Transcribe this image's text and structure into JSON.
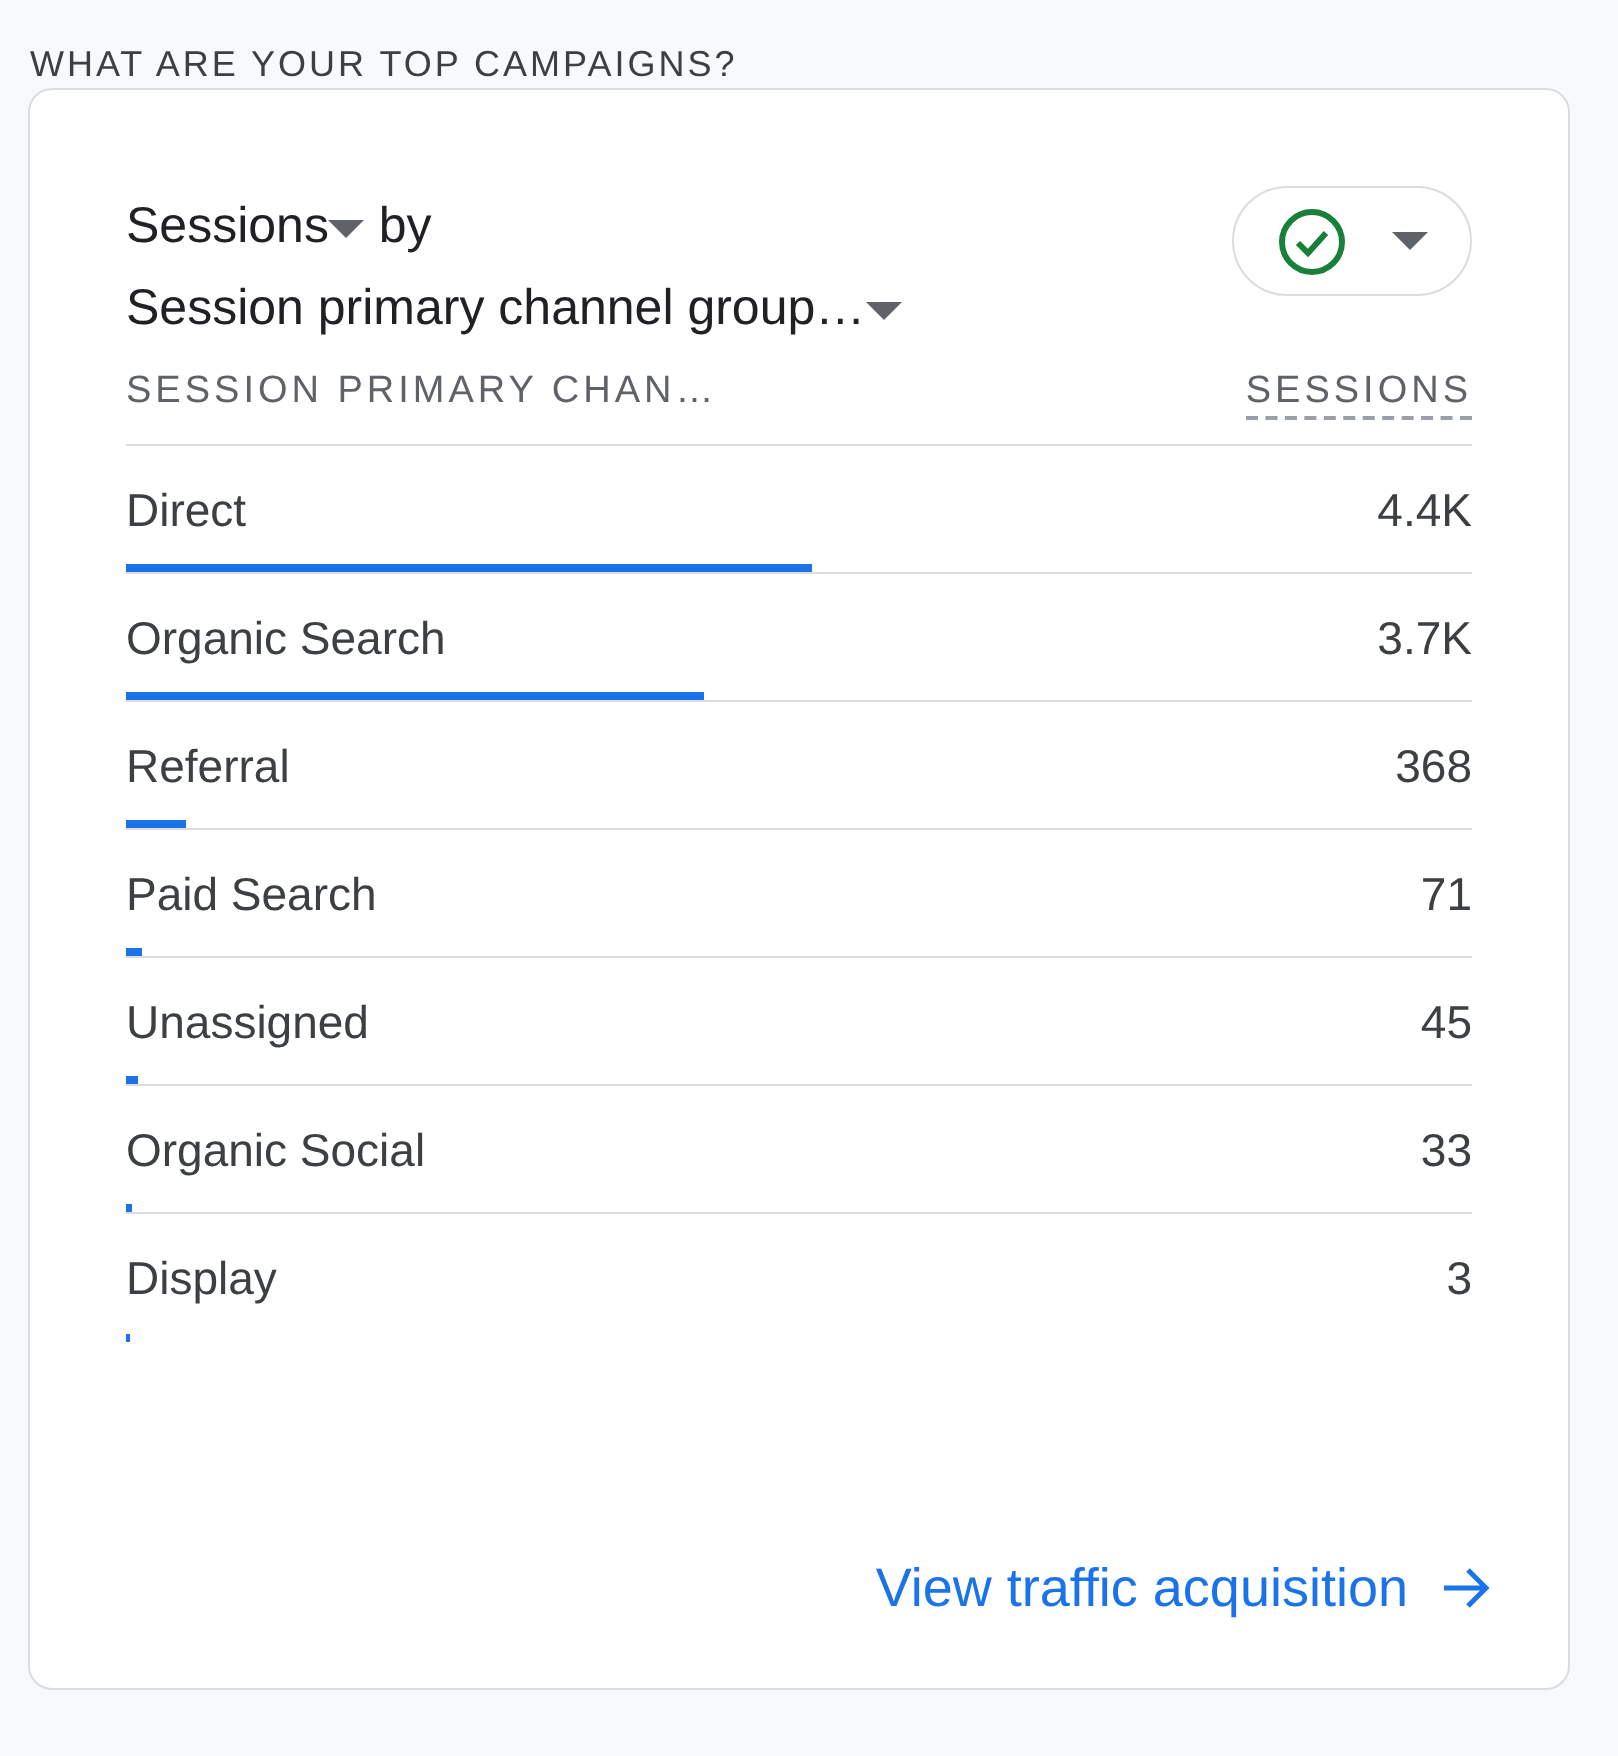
{
  "section_title": "WHAT ARE YOUR TOP CAMPAIGNS?",
  "card": {
    "metric": "Sessions",
    "by": "by",
    "dimension": "Session primary channel group…",
    "columns": [
      "SESSION PRIMARY CHAN…",
      "SESSIONS"
    ],
    "rows": [
      {
        "label": "Direct",
        "value": "4.4K",
        "level": 0.51
      },
      {
        "label": "Organic Search",
        "value": "3.7K",
        "level": 0.43
      },
      {
        "label": "Referral",
        "value": "368",
        "level": 0.045
      },
      {
        "label": "Paid Search",
        "value": "71",
        "level": 0.012
      },
      {
        "label": "Unassigned",
        "value": "45",
        "level": 0.009
      },
      {
        "label": "Organic Social",
        "value": "33",
        "level": 0.004
      },
      {
        "label": "Display",
        "value": "3",
        "level": 0.003
      }
    ],
    "link": "View traffic acquisition"
  }
}
